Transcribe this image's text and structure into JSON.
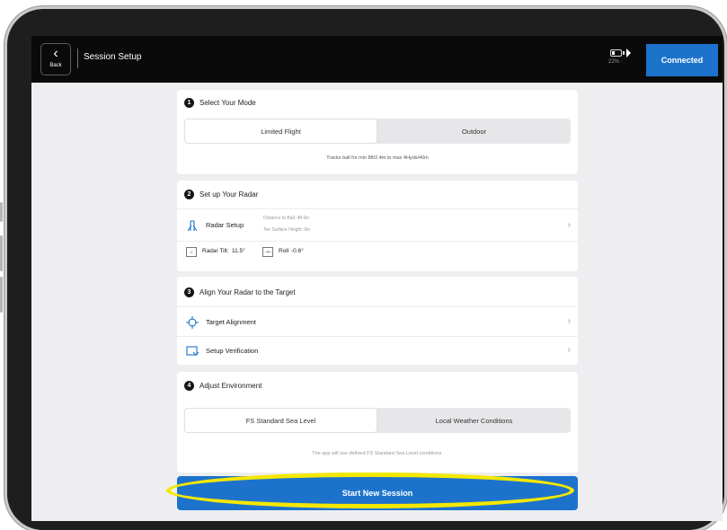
{
  "header": {
    "back_label": "Back",
    "title": "Session Setup",
    "battery_text": "22% ·",
    "connected_label": "Connected"
  },
  "mode": {
    "number": "1",
    "title": "Select Your Mode",
    "options": [
      "Limited Flight",
      "Outdoor"
    ],
    "selected": "Limited Flight",
    "note": "Tracks ball for min 8ft/2.4m to max 4Hyds/40m"
  },
  "radar": {
    "number": "2",
    "title": "Set up Your Radar",
    "setup_label": "Radar Setup",
    "distance_text": "Distance to Ball: 4ft 0in",
    "height_text": "Tee Surface Height: 0in",
    "tilt_label": "Radar Tilt:",
    "tilt_value": "11.5°",
    "roll_label": "Roll",
    "roll_value": "-0.6°"
  },
  "align": {
    "number": "3",
    "title": "Align Your Radar to the Target",
    "items": [
      "Target Alignment",
      "Setup Verification"
    ]
  },
  "environment": {
    "number": "4",
    "title": "Adjust Environment",
    "options": [
      "FS Standard Sea Level",
      "Local Weather Conditions"
    ],
    "selected": "FS Standard Sea Level",
    "note": "The app will use defined FS Standard Sea Level conditions."
  },
  "start_button": "Start New Session",
  "colors": {
    "accent": "#1d73cc",
    "highlight": "#f5e800",
    "good_value": "#2eae3f"
  }
}
